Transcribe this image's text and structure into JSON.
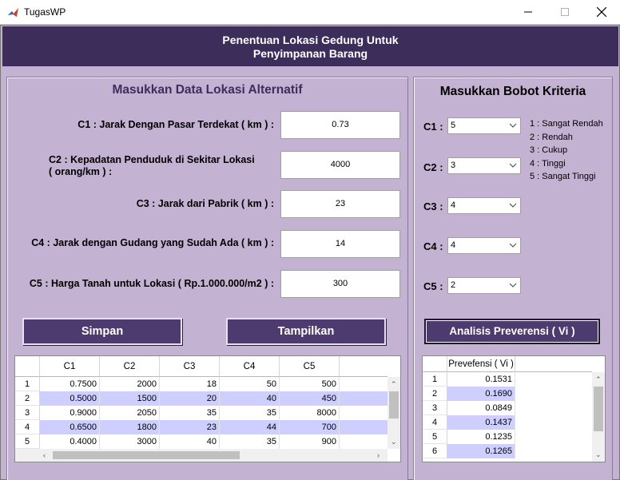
{
  "window": {
    "title": "TugasWP"
  },
  "header": {
    "line1": "Penentuan Lokasi Gedung Untuk",
    "line2": "Penyimpanan Barang"
  },
  "left_panel": {
    "title": "Masukkan Data Lokasi Alternatif",
    "fields": [
      {
        "label": "C1 : Jarak Dengan Pasar Terdekat ( km ) :",
        "value": "0.73"
      },
      {
        "label_line1": "C2 : Kepadatan Penduduk di Sekitar Lokasi",
        "label_line2": "( orang/km ) :",
        "value": "4000"
      },
      {
        "label": "C3 : Jarak dari Pabrik ( km ) :",
        "value": "23"
      },
      {
        "label": "C4 : Jarak dengan Gudang yang Sudah Ada ( km ) :",
        "value": "14"
      },
      {
        "label": "C5 : Harga Tanah untuk Lokasi (  Rp.1.000.000/m2 ) :",
        "value": "300"
      }
    ],
    "buttons": {
      "save": "Simpan",
      "show": "Tampilkan"
    },
    "table": {
      "columns": [
        "C1",
        "C2",
        "C3",
        "C4",
        "C5"
      ],
      "row_headers": [
        "1",
        "2",
        "3",
        "4",
        "5"
      ],
      "rows": [
        [
          "0.7500",
          "2000",
          "18",
          "50",
          "500"
        ],
        [
          "0.5000",
          "1500",
          "20",
          "40",
          "450"
        ],
        [
          "0.9000",
          "2050",
          "35",
          "35",
          "8000"
        ],
        [
          "0.6500",
          "1800",
          "23",
          "44",
          "700"
        ],
        [
          "0.4000",
          "3000",
          "40",
          "35",
          "900"
        ]
      ]
    }
  },
  "right_panel": {
    "title": "Masukkan Bobot Kriteria",
    "criteria": [
      {
        "label": "C1 :",
        "value": "5"
      },
      {
        "label": "C2 :",
        "value": "3"
      },
      {
        "label": "C3 :",
        "value": "4"
      },
      {
        "label": "C4 :",
        "value": "4"
      },
      {
        "label": "C5 :",
        "value": "2"
      }
    ],
    "legend": [
      "1 : Sangat Rendah",
      "2 : Rendah",
      "3 : Cukup",
      "4 : Tinggi",
      "5 : Sangat Tinggi"
    ],
    "analyze_button": "Analisis Preverensi  ( Vi )",
    "table": {
      "column": "Prevefensi ( Vi )",
      "row_headers": [
        "1",
        "2",
        "3",
        "4",
        "5",
        "6"
      ],
      "values": [
        "0.1531",
        "0.1690",
        "0.0849",
        "0.1437",
        "0.1235",
        "0.1265"
      ]
    }
  },
  "colors": {
    "header_bg": "#3d2d5a",
    "panel_bg": "#c4b2d2",
    "button_bg": "#4d3a6e",
    "row_stripe": "#cfcfff",
    "title_text_left": "#3d2d5a"
  }
}
